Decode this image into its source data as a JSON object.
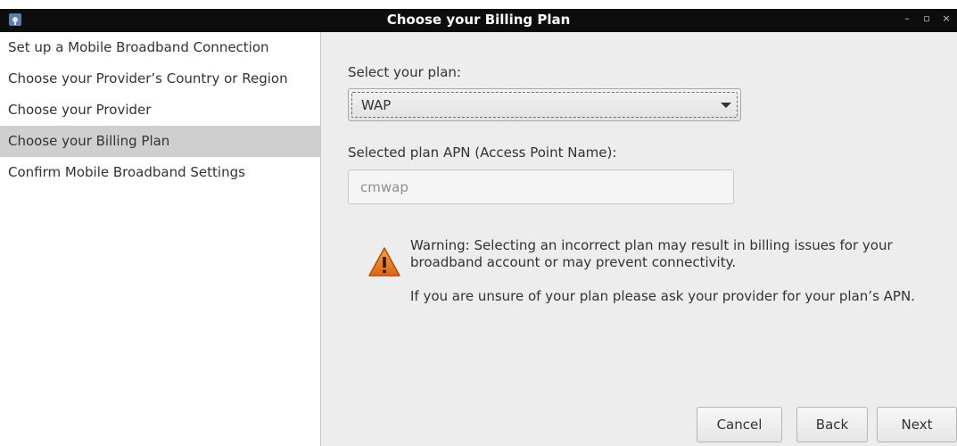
{
  "window": {
    "title": "Choose your Billing Plan",
    "controls": {
      "minimize": "–",
      "maximize": "▫",
      "close": "×"
    }
  },
  "sidebar": {
    "items": [
      {
        "label": "Set up a Mobile Broadband Connection",
        "selected": false
      },
      {
        "label": "Choose your Provider’s Country or Region",
        "selected": false
      },
      {
        "label": "Choose your Provider",
        "selected": false
      },
      {
        "label": "Choose your Billing Plan",
        "selected": true
      },
      {
        "label": "Confirm Mobile Broadband Settings",
        "selected": false
      }
    ]
  },
  "plan": {
    "label": "Select your plan:",
    "selected": "WAP"
  },
  "apn": {
    "label": "Selected plan APN (Access Point Name):",
    "value": "cmwap"
  },
  "warning": {
    "icon": "warning-icon",
    "text": "Warning: Selecting an incorrect plan may result in billing issues for your broadband account or may prevent connectivity.",
    "hint": "If you are unsure of your plan please ask your provider for your plan’s APN."
  },
  "buttons": {
    "cancel": "Cancel",
    "back": "Back",
    "next": "Next"
  }
}
